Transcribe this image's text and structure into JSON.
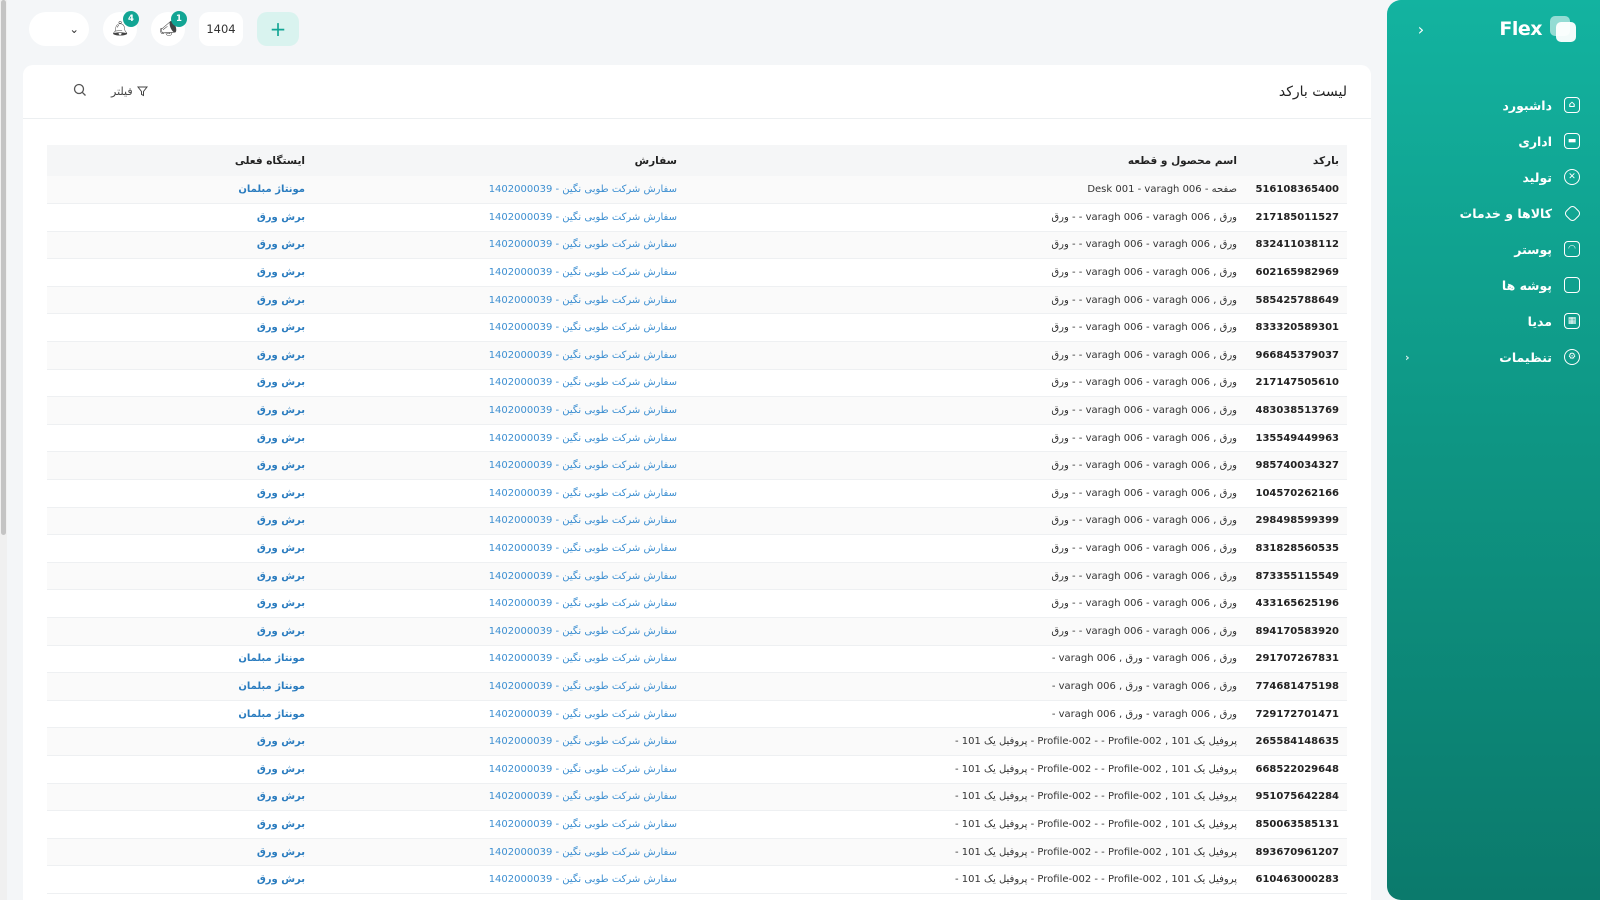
{
  "brand": {
    "name": "Flex"
  },
  "sidebar": {
    "items": [
      {
        "label": "داشبورد",
        "icon": "home-icon"
      },
      {
        "label": "اداری",
        "icon": "briefcase-icon"
      },
      {
        "label": "تولید",
        "icon": "tools-icon"
      },
      {
        "label": "کالاها و خدمات",
        "icon": "box-icon"
      },
      {
        "label": "پوستر",
        "icon": "image-icon"
      },
      {
        "label": "پوشه ها",
        "icon": "folder-icon"
      },
      {
        "label": "مدیا",
        "icon": "media-icon"
      },
      {
        "label": "تنظیمات",
        "icon": "gear-icon"
      }
    ]
  },
  "topbar": {
    "notification_count": "4",
    "announcement_count": "1",
    "year": "1404",
    "add_symbol": "+"
  },
  "card": {
    "title": "لیست بارکد",
    "filter_label": "فیلتر"
  },
  "table": {
    "headers": {
      "barcode": "بارکد",
      "product": "اسم محصول و قطعه",
      "order": "سفارش",
      "station": "ایستگاه فعلی"
    },
    "rows": [
      {
        "barcode": "516108365400",
        "product": "صفحه - Desk 001 - varagh 006",
        "order": "سفارش شرکت طوبی نگین - 1402000039",
        "station": "مونتاژ مبلمان"
      },
      {
        "barcode": "217185011527",
        "product": "ورق , varagh 006 - varagh 006 - - ورق",
        "order": "سفارش شرکت طوبی نگین - 1402000039",
        "station": "برش ورق"
      },
      {
        "barcode": "832411038112",
        "product": "ورق , varagh 006 - varagh 006 - - ورق",
        "order": "سفارش شرکت طوبی نگین - 1402000039",
        "station": "برش ورق"
      },
      {
        "barcode": "602165982969",
        "product": "ورق , varagh 006 - varagh 006 - - ورق",
        "order": "سفارش شرکت طوبی نگین - 1402000039",
        "station": "برش ورق"
      },
      {
        "barcode": "585425788649",
        "product": "ورق , varagh 006 - varagh 006 - - ورق",
        "order": "سفارش شرکت طوبی نگین - 1402000039",
        "station": "برش ورق"
      },
      {
        "barcode": "833320589301",
        "product": "ورق , varagh 006 - varagh 006 - - ورق",
        "order": "سفارش شرکت طوبی نگین - 1402000039",
        "station": "برش ورق"
      },
      {
        "barcode": "966845379037",
        "product": "ورق , varagh 006 - varagh 006 - - ورق",
        "order": "سفارش شرکت طوبی نگین - 1402000039",
        "station": "برش ورق"
      },
      {
        "barcode": "217147505610",
        "product": "ورق , varagh 006 - varagh 006 - - ورق",
        "order": "سفارش شرکت طوبی نگین - 1402000039",
        "station": "برش ورق"
      },
      {
        "barcode": "483038513769",
        "product": "ورق , varagh 006 - varagh 006 - - ورق",
        "order": "سفارش شرکت طوبی نگین - 1402000039",
        "station": "برش ورق"
      },
      {
        "barcode": "135549449963",
        "product": "ورق , varagh 006 - varagh 006 - - ورق",
        "order": "سفارش شرکت طوبی نگین - 1402000039",
        "station": "برش ورق"
      },
      {
        "barcode": "985740034327",
        "product": "ورق , varagh 006 - varagh 006 - - ورق",
        "order": "سفارش شرکت طوبی نگین - 1402000039",
        "station": "برش ورق"
      },
      {
        "barcode": "104570262166",
        "product": "ورق , varagh 006 - varagh 006 - - ورق",
        "order": "سفارش شرکت طوبی نگین - 1402000039",
        "station": "برش ورق"
      },
      {
        "barcode": "298498599399",
        "product": "ورق , varagh 006 - varagh 006 - - ورق",
        "order": "سفارش شرکت طوبی نگین - 1402000039",
        "station": "برش ورق"
      },
      {
        "barcode": "831828560535",
        "product": "ورق , varagh 006 - varagh 006 - - ورق",
        "order": "سفارش شرکت طوبی نگین - 1402000039",
        "station": "برش ورق"
      },
      {
        "barcode": "873355115549",
        "product": "ورق , varagh 006 - varagh 006 - - ورق",
        "order": "سفارش شرکت طوبی نگین - 1402000039",
        "station": "برش ورق"
      },
      {
        "barcode": "433165625196",
        "product": "ورق , varagh 006 - varagh 006 - - ورق",
        "order": "سفارش شرکت طوبی نگین - 1402000039",
        "station": "برش ورق"
      },
      {
        "barcode": "894170583920",
        "product": "ورق , varagh 006 - varagh 006 - - ورق",
        "order": "سفارش شرکت طوبی نگین - 1402000039",
        "station": "برش ورق"
      },
      {
        "barcode": "291707267831",
        "product": "ورق , varagh 006 - ورق , varagh 006 -",
        "order": "سفارش شرکت طوبی نگین - 1402000039",
        "station": "مونتاژ مبلمان"
      },
      {
        "barcode": "774681475198",
        "product": "ورق , varagh 006 - ورق , varagh 006 -",
        "order": "سفارش شرکت طوبی نگین - 1402000039",
        "station": "مونتاژ مبلمان"
      },
      {
        "barcode": "729172701471",
        "product": "ورق , varagh 006 - ورق , varagh 006 -",
        "order": "سفارش شرکت طوبی نگین - 1402000039",
        "station": "مونتاژ مبلمان"
      },
      {
        "barcode": "265584148635",
        "product": "پروفیل یک 101 , Profile-002 - - Profile-002 - پروفیل یک 101 -",
        "order": "سفارش شرکت طوبی نگین - 1402000039",
        "station": "برش ورق"
      },
      {
        "barcode": "668522029648",
        "product": "پروفیل یک 101 , Profile-002 - - Profile-002 - پروفیل یک 101 -",
        "order": "سفارش شرکت طوبی نگین - 1402000039",
        "station": "برش ورق"
      },
      {
        "barcode": "951075642284",
        "product": "پروفیل یک 101 , Profile-002 - - Profile-002 - پروفیل یک 101 -",
        "order": "سفارش شرکت طوبی نگین - 1402000039",
        "station": "برش ورق"
      },
      {
        "barcode": "850063585131",
        "product": "پروفیل یک 101 , Profile-002 - - Profile-002 - پروفیل یک 101 -",
        "order": "سفارش شرکت طوبی نگین - 1402000039",
        "station": "برش ورق"
      },
      {
        "barcode": "893670961207",
        "product": "پروفیل یک 101 , Profile-002 - - Profile-002 - پروفیل یک 101 -",
        "order": "سفارش شرکت طوبی نگین - 1402000039",
        "station": "برش ورق"
      },
      {
        "barcode": "610463000283",
        "product": "پروفیل یک 101 , Profile-002 - - Profile-002 - پروفیل یک 101 -",
        "order": "سفارش شرکت طوبی نگین - 1402000039",
        "station": "برش ورق"
      }
    ]
  }
}
